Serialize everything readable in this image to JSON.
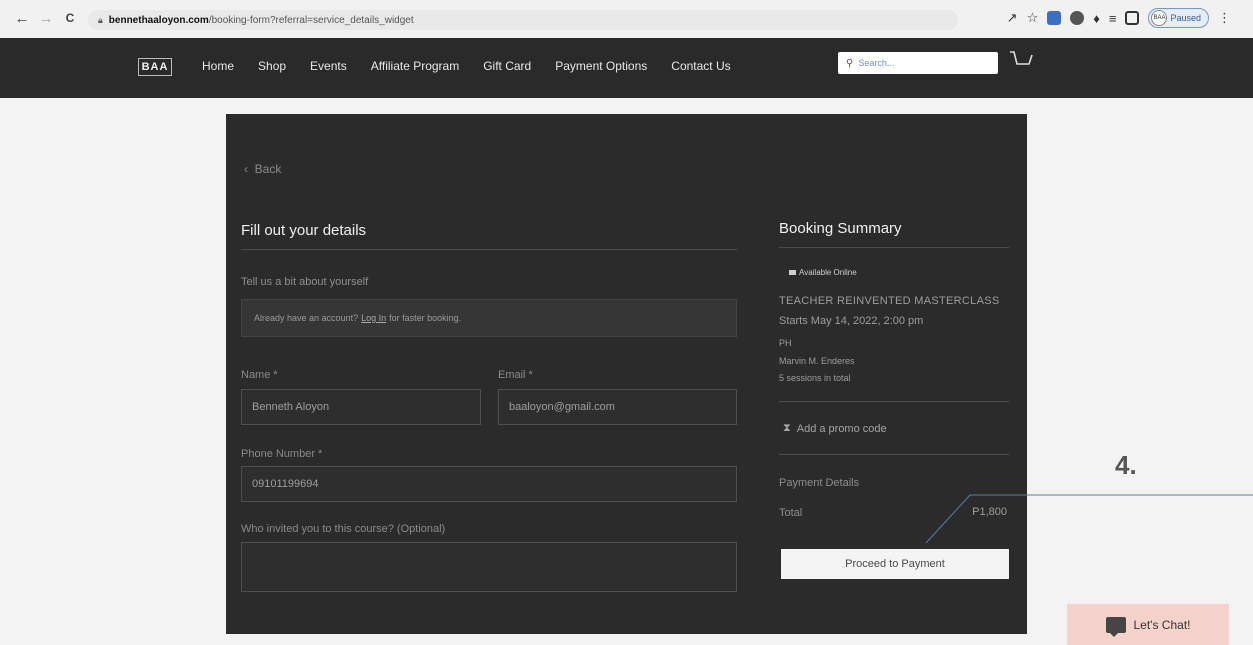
{
  "browser": {
    "back_glyph": "←",
    "forward_glyph": "→",
    "reload_glyph": "C",
    "url_domain": "bennethaaloyon.com",
    "url_path": "/booking-form?referral=service_details_widget",
    "profile_label": "Paused",
    "avatar_text": "BAA"
  },
  "header": {
    "logo_text": "BAA",
    "nav": [
      "Home",
      "Shop",
      "Events",
      "Affiliate Program",
      "Gift Card",
      "Payment Options",
      "Contact Us"
    ],
    "search_placeholder": "Search..."
  },
  "form": {
    "back_label": "Back",
    "title": "Fill out your details",
    "subtitle": "Tell us a bit about yourself",
    "login_prefix": "Already have an account?",
    "login_link": "Log In",
    "login_suffix": "for faster booking.",
    "name_label": "Name *",
    "name_value": "Benneth Aloyon",
    "email_label": "Email *",
    "email_value": "baaloyon@gmail.com",
    "phone_label": "Phone Number *",
    "phone_value": "09101199694",
    "invited_label": "Who invited you to this course? (Optional)",
    "invited_value": ""
  },
  "summary": {
    "title": "Booking Summary",
    "badge": "Available Online",
    "course": "TEACHER REINVENTED MASTERCLASS",
    "starts": "Starts May 14, 2022, 2:00 pm",
    "location": "PH",
    "instructor": "Marvin M. Enderes",
    "sessions": "5 sessions in total",
    "promo": "Add a promo code",
    "payment_details": "Payment Details",
    "total_label": "Total",
    "total_value": "P1,800",
    "proceed": "Proceed to Payment"
  },
  "annotation": {
    "number": "4."
  },
  "chat": {
    "label": "Let's Chat!"
  }
}
